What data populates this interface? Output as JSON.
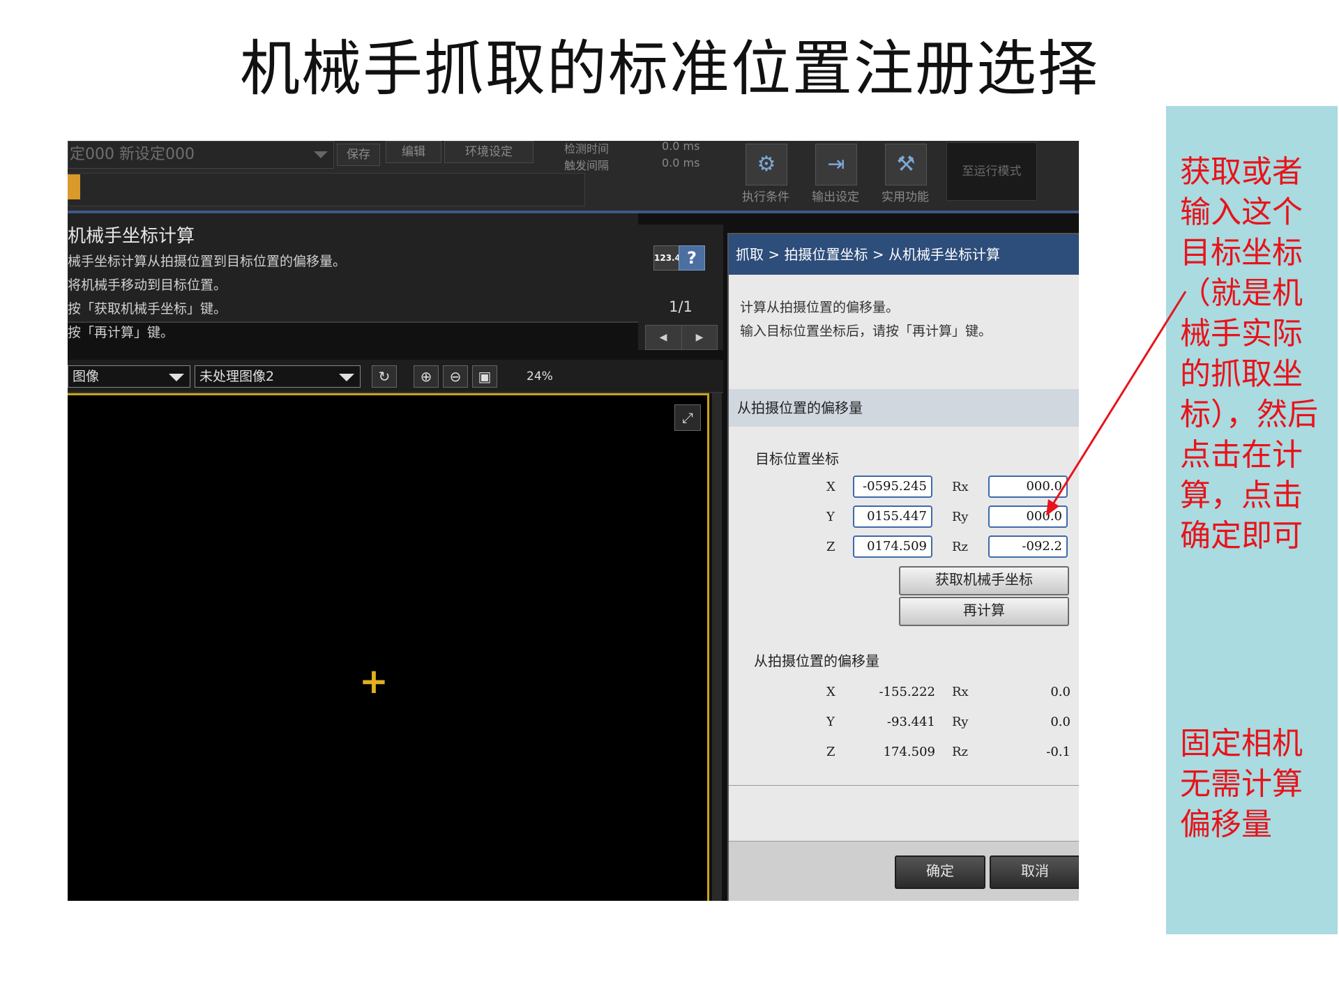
{
  "slide": {
    "title": "机械手抓取的标准位置注册选择"
  },
  "toolbar": {
    "setting_text": "定000 新设定000",
    "save_label": "保存",
    "edit_label": "编辑",
    "env_label": "环境设定",
    "detect_time_label": "检测时间",
    "trigger_interval_label": "触发间隔",
    "detect_time_value": "0.0 ms",
    "trigger_interval_value": "0.0 ms",
    "exec_condition_label": "执行条件",
    "output_setting_label": "输出设定",
    "utility_label": "实用功能",
    "run_mode_label": "至运行模式"
  },
  "description": {
    "title": "机械手坐标计算",
    "lines": [
      "械手坐标计算从拍摄位置到目标位置的偏移量。",
      "将机械手移动到目标位置。",
      "按「获取机械手坐标」键。",
      "按「再计算」键。"
    ]
  },
  "pager": {
    "icon_label": "123.4",
    "help_label": "?",
    "page": "1/1",
    "prev": "◀",
    "next": "▶"
  },
  "image_bar": {
    "image_select": "图像",
    "image_type_select": "未处理图像2",
    "zoom": "24%"
  },
  "dialog": {
    "breadcrumb": "抓取 > 拍摄位置坐标 > 从机械手坐标计算",
    "desc_line1": "计算从拍摄位置的偏移量。",
    "desc_line2": "输入目标位置坐标后，请按「再计算」键。",
    "section_title": "从拍摄位置的偏移量",
    "target_coords_label": "目标位置坐标",
    "target": {
      "x_label": "X",
      "x_value": "-0595.245",
      "y_label": "Y",
      "y_value": "0155.447",
      "z_label": "Z",
      "z_value": "0174.509",
      "rx_label": "Rx",
      "rx_value": "000.0",
      "ry_label": "Ry",
      "ry_value": "000.0",
      "rz_label": "Rz",
      "rz_value": "-092.2"
    },
    "get_robot_coords_label": "获取机械手坐标",
    "recalc_label": "再计算",
    "offset_label": "从拍摄位置的偏移量",
    "offset": {
      "x_label": "X",
      "x_value": "-155.222",
      "y_label": "Y",
      "y_value": "-93.441",
      "z_label": "Z",
      "z_value": "174.509",
      "rx_label": "Rx",
      "rx_value": "0.0",
      "ry_label": "Ry",
      "ry_value": "0.0",
      "rz_label": "Rz",
      "rz_value": "-0.1"
    },
    "ok_label": "确定",
    "cancel_label": "取消"
  },
  "annotations": {
    "note1": "获取或者输入这个目标坐标（就是机械手实际的抓取坐标），然后点击在计算，点击确定即可",
    "note2": "固定相机无需计算偏移量",
    "note_color": "#e8131b",
    "panel_color": "#a9dbe0"
  }
}
